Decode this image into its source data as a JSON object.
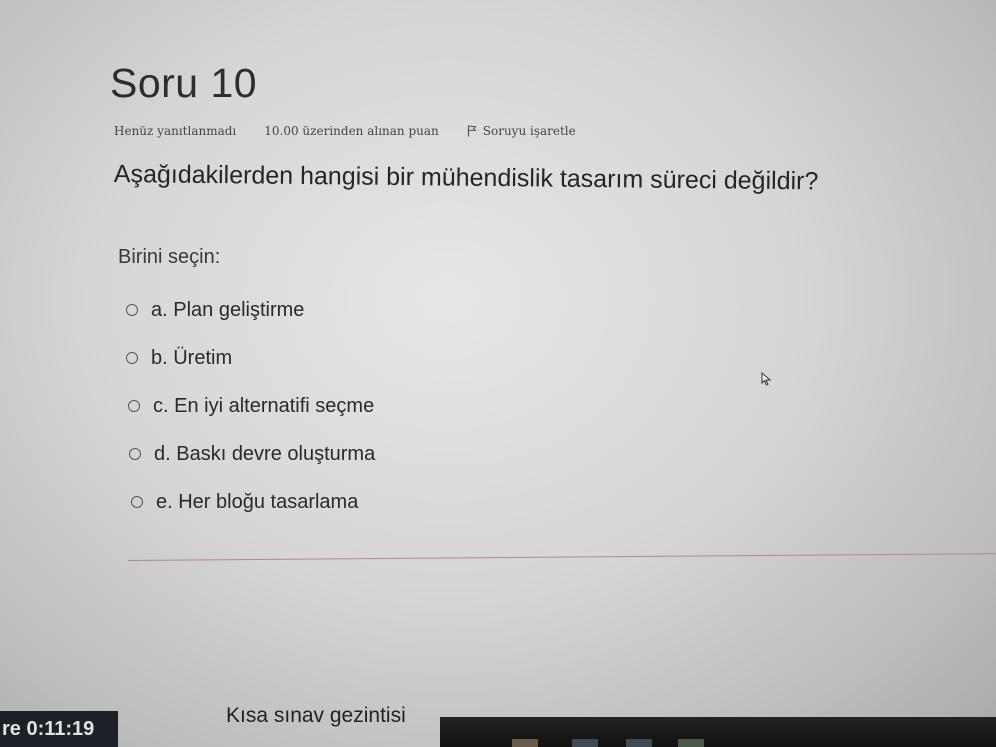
{
  "question": {
    "title": "Soru 10",
    "status": "Henüz yanıtlanmadı",
    "points": "10.00 üzerinden alınan puan",
    "flag_label": "Soruyu işaretle",
    "text": "Aşağıdakilerden hangisi bir mühendislik tasarım süreci değildir?",
    "prompt": "Birini seçin:",
    "options": [
      {
        "label": "a. Plan geliştirme"
      },
      {
        "label": "b. Üretim"
      },
      {
        "label": "c. En iyi alternatifi seçme"
      },
      {
        "label": "d. Baskı devre oluşturma"
      },
      {
        "label": "e. Her bloğu tasarlama"
      }
    ]
  },
  "footer": {
    "timer": "re 0:11:19",
    "nav_title": "Kısa sınav gezintisi"
  },
  "icons": {
    "flag": "flag-icon",
    "radio": "radio-icon",
    "cursor": "mouse-pointer-icon"
  }
}
